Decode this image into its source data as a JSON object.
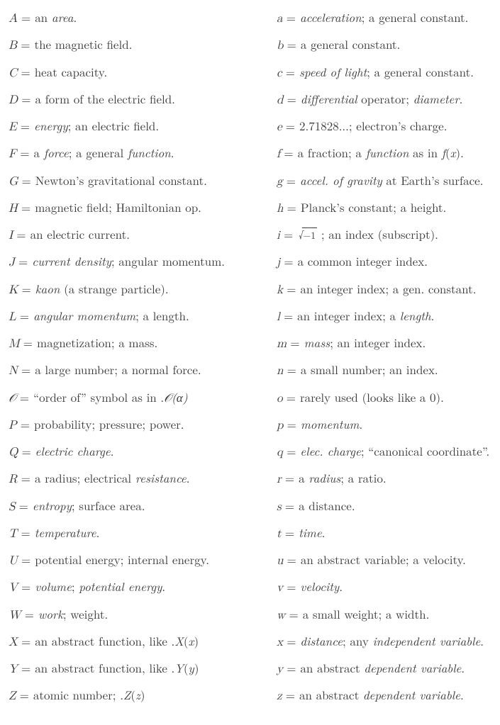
{
  "rows": [
    {
      "upSym": "A",
      "upDesc_pre": "an ",
      "upDesc_it": "area",
      "upDesc_post": ".",
      "loSym": "a",
      "loDesc_pre": "",
      "loDesc_it": "acceleration",
      "loDesc_post": "; a general constant."
    },
    {
      "upSym": "B",
      "upDesc_pre": "the magnetic field.",
      "upDesc_it": "",
      "upDesc_post": "",
      "loSym": "b",
      "loDesc_pre": "a general constant.",
      "loDesc_it": "",
      "loDesc_post": ""
    },
    {
      "upSym": "C",
      "upDesc_pre": "heat capacity.",
      "upDesc_it": "",
      "upDesc_post": "",
      "loSym": "c",
      "loDesc_pre": "",
      "loDesc_it": "speed of light",
      "loDesc_post": "; a general constant."
    },
    {
      "upSym": "D",
      "upDesc_pre": "a form of the electric field.",
      "upDesc_it": "",
      "upDesc_post": "",
      "loSym": "d",
      "loDesc_pre": "",
      "loDesc_it": "differential",
      "loDesc_post": " operator; ",
      "loDesc_it2": "diameter",
      "loDesc_post2": "."
    },
    {
      "upSym": "E",
      "upDesc_pre": "",
      "upDesc_it": "energy",
      "upDesc_post": "; an electric field.",
      "loSym": "e",
      "loDesc_pre": "2.71828...; electron’s charge.",
      "loDesc_it": "",
      "loDesc_post": ""
    },
    {
      "upSym": "F",
      "upDesc_pre": "a ",
      "upDesc_it": "force",
      "upDesc_post": "; a general ",
      "upDesc_it2": "function",
      "upDesc_post2": ".",
      "loSym": "f",
      "loDesc_pre": "a fraction; a ",
      "loDesc_it": "function",
      "loDesc_post": " as in ",
      "loDesc_math": "f(x)",
      "loDesc_post2": "."
    },
    {
      "upSym": "G",
      "upDesc_pre": "Newton’s gravitational constant.",
      "upDesc_it": "",
      "upDesc_post": "",
      "loSym": "g",
      "loDesc_pre": "",
      "loDesc_it": "accel. of gravity",
      "loDesc_post": " at Earth’s surface."
    },
    {
      "upSym": "H",
      "upDesc_pre": "magnetic field; Hamiltonian op.",
      "upDesc_it": "",
      "upDesc_post": "",
      "loSym": "h",
      "loDesc_pre": "Planck’s constant; a height.",
      "loDesc_it": "",
      "loDesc_post": ""
    },
    {
      "upSym": "I",
      "upDesc_pre": "an electric current.",
      "upDesc_it": "",
      "upDesc_post": "",
      "loSym": "i",
      "loDesc_sqrt": "−1",
      "loDesc_post": " ; an index (subscript)."
    },
    {
      "upSym": "J",
      "upDesc_pre": "",
      "upDesc_it": "current density",
      "upDesc_post": "; angular momentum.",
      "loSym": "j",
      "loDesc_pre": "a common integer index.",
      "loDesc_it": "",
      "loDesc_post": ""
    },
    {
      "upSym": "K",
      "upDesc_pre": "",
      "upDesc_it": "kaon",
      "upDesc_post": " (a strange particle).",
      "loSym": "k",
      "loDesc_pre": "an integer index; a gen. constant.",
      "loDesc_it": "",
      "loDesc_post": ""
    },
    {
      "upSym": "L",
      "upDesc_pre": "",
      "upDesc_it": "angular momentum",
      "upDesc_post": "; a length.",
      "loSym": "l",
      "loDesc_pre": "an integer index; a ",
      "loDesc_it": "length",
      "loDesc_post": "."
    },
    {
      "upSym": "M",
      "upDesc_pre": "magnetization; a mass.",
      "upDesc_it": "",
      "upDesc_post": "",
      "loSym": "m",
      "loDesc_pre": "",
      "loDesc_it": "mass",
      "loDesc_post": "; an integer index."
    },
    {
      "upSym": "N",
      "upDesc_pre": "a large number; a normal force.",
      "upDesc_it": "",
      "upDesc_post": "",
      "loSym": "n",
      "loDesc_pre": "a small number; an index.",
      "loDesc_it": "",
      "loDesc_post": ""
    },
    {
      "upSym_cal": "O",
      "upDesc_pre": "“order of” symbol as in ",
      "upDesc_math": "𝒪(α)",
      "upDesc_post": ".",
      "loSym": "o",
      "loDesc_pre": "rarely used (looks like a 0).",
      "loDesc_it": "",
      "loDesc_post": ""
    },
    {
      "upSym": "P",
      "upDesc_pre": "probability; pressure; power.",
      "upDesc_it": "",
      "upDesc_post": "",
      "loSym": "p",
      "loDesc_pre": "",
      "loDesc_it": "momentum",
      "loDesc_post": "."
    },
    {
      "upSym": "Q",
      "upDesc_pre": "",
      "upDesc_it": "electric charge",
      "upDesc_post": ".",
      "loSym": "q",
      "loDesc_pre": "",
      "loDesc_it": "elec. charge",
      "loDesc_post": "; “canonical coordinate”."
    },
    {
      "upSym": "R",
      "upDesc_pre": "a radius; electrical ",
      "upDesc_it": "resistance",
      "upDesc_post": ".",
      "loSym": "r",
      "loDesc_pre": "a ",
      "loDesc_it": "radius",
      "loDesc_post": "; a ratio."
    },
    {
      "upSym": "S",
      "upDesc_pre": "",
      "upDesc_it": "entropy",
      "upDesc_post": "; surface area.",
      "loSym": "s",
      "loDesc_pre": "a distance.",
      "loDesc_it": "",
      "loDesc_post": ""
    },
    {
      "upSym": "T",
      "upDesc_pre": "",
      "upDesc_it": "temperature",
      "upDesc_post": ".",
      "loSym": "t",
      "loDesc_pre": "",
      "loDesc_it": "time",
      "loDesc_post": "."
    },
    {
      "upSym": "U",
      "upDesc_pre": "potential energy; internal energy.",
      "upDesc_it": "",
      "upDesc_post": "",
      "loSym": "u",
      "loDesc_pre": "an abstract variable; a velocity.",
      "loDesc_it": "",
      "loDesc_post": ""
    },
    {
      "upSym": "V",
      "upDesc_pre": "",
      "upDesc_it": "volume",
      "upDesc_post": "; ",
      "upDesc_it2": "potential energy",
      "upDesc_post2": ".",
      "loSym": "v",
      "loDesc_pre": "",
      "loDesc_it": "velocity",
      "loDesc_post": "."
    },
    {
      "upSym": "W",
      "upDesc_pre": "",
      "upDesc_it": "work",
      "upDesc_post": "; weight.",
      "loSym": "w",
      "loDesc_pre": "a small weight; a width.",
      "loDesc_it": "",
      "loDesc_post": ""
    },
    {
      "upSym": "X",
      "upDesc_pre": "an abstract function, like ",
      "upDesc_math": "X(x)",
      "upDesc_post": ".",
      "loSym": "x",
      "loDesc_pre": "",
      "loDesc_it": "distance",
      "loDesc_post": "; any ",
      "loDesc_it2": "independent variable",
      "loDesc_post2": "."
    },
    {
      "upSym": "Y",
      "upDesc_pre": "an abstract function, like ",
      "upDesc_math": "Y(y)",
      "upDesc_post": ".",
      "loSym": "y",
      "loDesc_pre": "an abstract ",
      "loDesc_it": "dependent variable",
      "loDesc_post": "."
    },
    {
      "upSym": "Z",
      "upDesc_pre": "atomic number; ",
      "upDesc_math": "Z(z)",
      "upDesc_post": ".",
      "loSym": "z",
      "loDesc_pre": "an abstract ",
      "loDesc_it": "dependent variable",
      "loDesc_post": "."
    }
  ],
  "eq": "="
}
